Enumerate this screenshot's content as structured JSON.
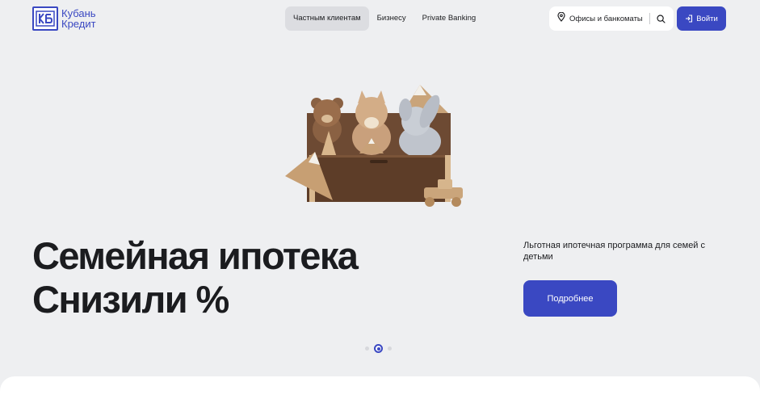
{
  "brand": {
    "name_line1": "Кубань",
    "name_line2": "Кредит",
    "color": "#3a48c2"
  },
  "nav": {
    "items": [
      {
        "label": "Частным клиентам",
        "active": true
      },
      {
        "label": "Бизнесу",
        "active": false
      },
      {
        "label": "Private Banking",
        "active": false
      }
    ]
  },
  "header": {
    "offices_label": "Офисы и банкоматы",
    "offices_icon": "location-pin-icon",
    "search_icon": "search-icon",
    "login_label": "Войти",
    "login_icon": "login-icon"
  },
  "hero": {
    "title_line1": "Семейная ипотека",
    "title_line2": "Снизили %",
    "subtitle": "Льготная ипотечная программа для семей с детьми",
    "button_label": "Подробнее",
    "slides_total": 3,
    "active_slide": 2
  },
  "colors": {
    "accent": "#3a48c2",
    "background": "#eeeff1"
  }
}
